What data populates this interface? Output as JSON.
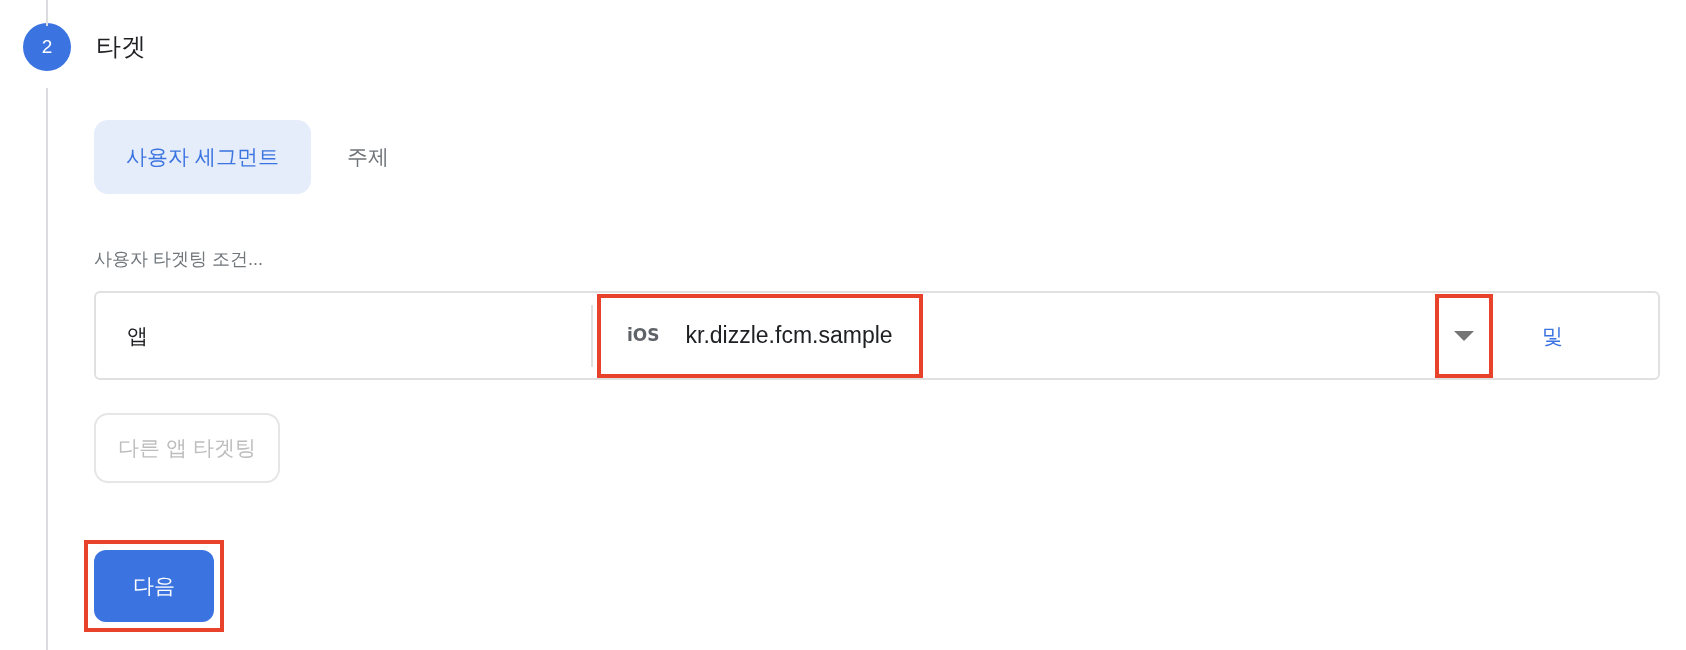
{
  "step": {
    "number": "2",
    "title": "타겟"
  },
  "tabs": [
    {
      "label": "사용자 세그먼트",
      "selected": true
    },
    {
      "label": "주제",
      "selected": false
    }
  ],
  "targeting": {
    "label": "사용자 타겟팅 조건...",
    "field": "앱",
    "platform": "iOS",
    "app": "kr.dizzle.fcm.sample",
    "app_highlighted": true,
    "dropdown_highlighted": true,
    "and_link": "및"
  },
  "other_app_button": {
    "label": "다른 앱 타겟팅",
    "disabled": true
  },
  "next_button": {
    "label": "다음",
    "highlighted": true
  }
}
